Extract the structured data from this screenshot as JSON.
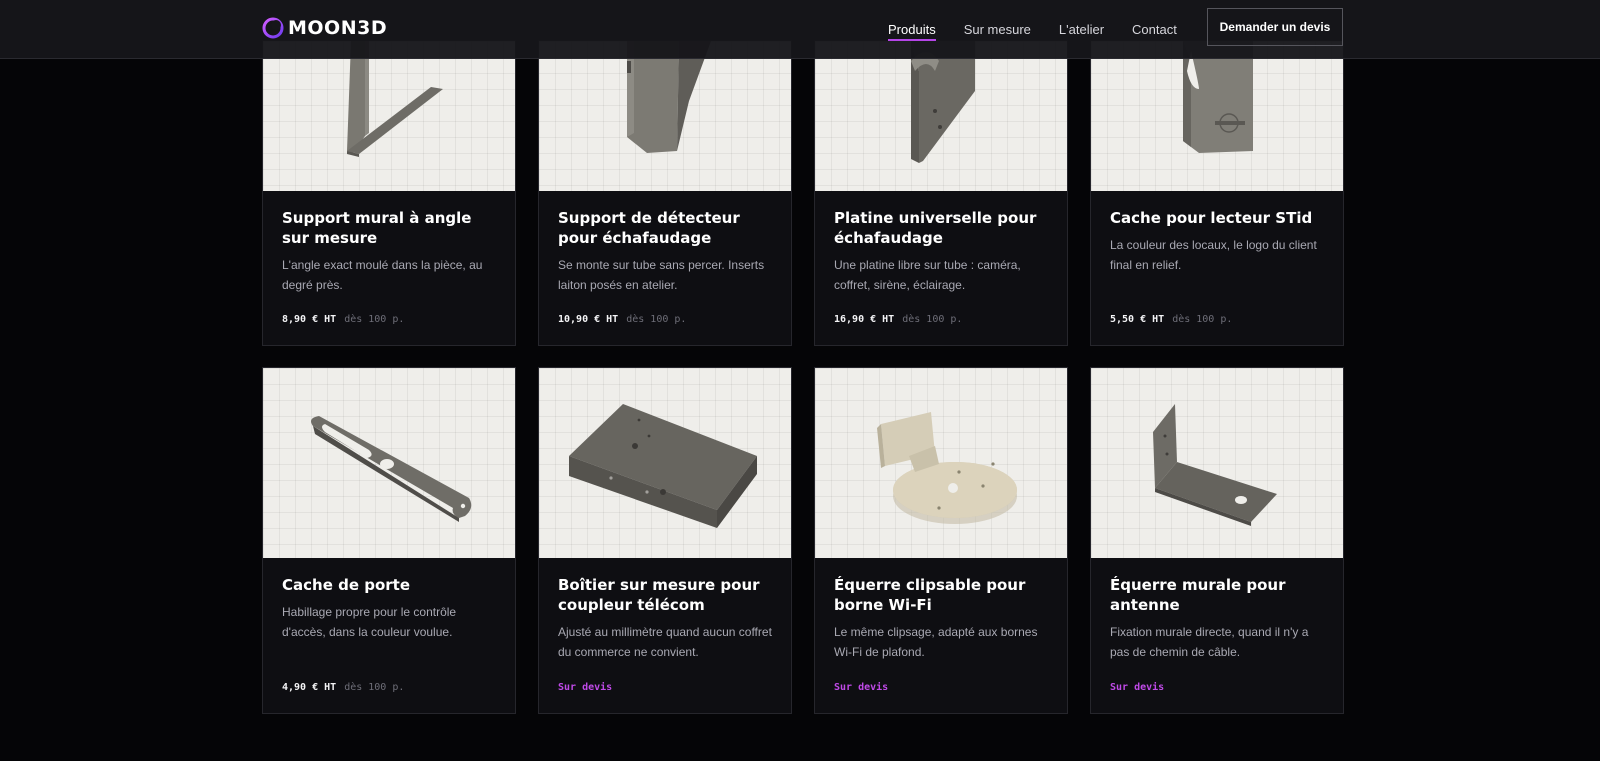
{
  "brand": {
    "name": "MOON3D",
    "accent": "#b545e8"
  },
  "nav": {
    "items": [
      {
        "label": "Produits",
        "active": true
      },
      {
        "label": "Sur mesure",
        "active": false
      },
      {
        "label": "L'atelier",
        "active": false
      },
      {
        "label": "Contact",
        "active": false
      }
    ],
    "cta_label": "Demander un devis"
  },
  "products": [
    {
      "title": "Support mural à angle sur mesure",
      "description": "L'angle exact moulé dans la pièce, au degré près.",
      "price": "8,90 € HT",
      "price_note": "dès 100 p.",
      "icon": "angled-wall-bracket"
    },
    {
      "title": "Support de détecteur pour échafaudage",
      "description": "Se monte sur tube sans percer. Inserts laiton posés en atelier.",
      "price": "10,90 € HT",
      "price_note": "dès 100 p.",
      "icon": "detector-bracket"
    },
    {
      "title": "Platine universelle pour échafaudage",
      "description": "Une platine libre sur tube : caméra, coffret, sirène, éclairage.",
      "price": "16,90 € HT",
      "price_note": "dès 100 p.",
      "icon": "universal-plate"
    },
    {
      "title": "Cache pour lecteur STid",
      "description": "La couleur des locaux, le logo du client final en relief.",
      "price": "5,50 € HT",
      "price_note": "dès 100 p.",
      "icon": "reader-cover"
    },
    {
      "title": "Cache de porte",
      "description": "Habillage propre pour le contrôle d'accès, dans la couleur voulue.",
      "price": "4,90 € HT",
      "price_note": "dès 100 p.",
      "icon": "door-cover"
    },
    {
      "title": "Boîtier sur mesure pour coupleur télécom",
      "description": "Ajusté au millimètre quand aucun coffret du commerce ne convient.",
      "quote": "Sur devis",
      "icon": "enclosure-box"
    },
    {
      "title": "Équerre clipsable pour borne Wi-Fi",
      "description": "Le même clipsage, adapté aux bornes Wi-Fi de plafond.",
      "quote": "Sur devis",
      "icon": "wifi-clip-bracket"
    },
    {
      "title": "Équerre murale pour antenne",
      "description": "Fixation murale directe, quand il n'y a pas de chemin de câble.",
      "quote": "Sur devis",
      "icon": "antenna-bracket"
    }
  ]
}
